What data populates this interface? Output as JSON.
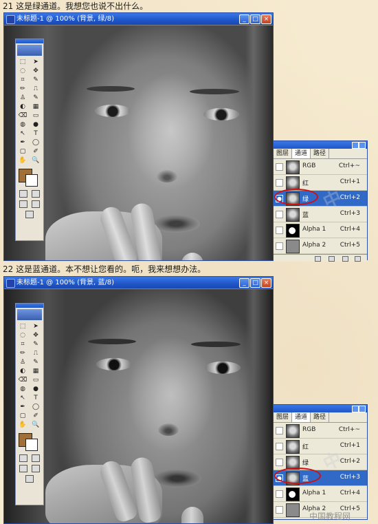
{
  "sections": [
    {
      "caption": "21 这是绿通道。我想您也说不出什么。",
      "window": {
        "title": "未标题-1 @ 100% (背景, 绿/8)",
        "buttons": {
          "minimize": "_",
          "maximize": "□",
          "close": "×"
        }
      },
      "channels_panel": {
        "tabs": [
          "图层",
          "通道",
          "路径"
        ],
        "active_tab": "通道",
        "rows": [
          {
            "name": "RGB",
            "shortcut": "Ctrl+~",
            "thumb": "face",
            "selected": false,
            "visible": false
          },
          {
            "name": "红",
            "shortcut": "Ctrl+1",
            "thumb": "face",
            "selected": false,
            "visible": false
          },
          {
            "name": "绿",
            "shortcut": "Ctrl+2",
            "thumb": "face",
            "selected": true,
            "visible": true
          },
          {
            "name": "蓝",
            "shortcut": "Ctrl+3",
            "thumb": "face",
            "selected": false,
            "visible": false
          },
          {
            "name": "Alpha 1",
            "shortcut": "Ctrl+4",
            "thumb": "alpha",
            "selected": false,
            "visible": false
          },
          {
            "name": "Alpha 2",
            "shortcut": "Ctrl+5",
            "thumb": "alpha2",
            "selected": false,
            "visible": false
          }
        ]
      }
    },
    {
      "caption": "22 这是蓝通道。本不想让您看的。呃，我来想想办法。",
      "window": {
        "title": "未标题-1 @ 100% (背景, 蓝/8)",
        "buttons": {
          "minimize": "_",
          "maximize": "□",
          "close": "×"
        }
      },
      "channels_panel": {
        "tabs": [
          "图层",
          "通道",
          "路径"
        ],
        "active_tab": "通道",
        "rows": [
          {
            "name": "RGB",
            "shortcut": "Ctrl+~",
            "thumb": "face",
            "selected": false,
            "visible": false
          },
          {
            "name": "红",
            "shortcut": "Ctrl+1",
            "thumb": "face",
            "selected": false,
            "visible": false
          },
          {
            "name": "绿",
            "shortcut": "Ctrl+2",
            "thumb": "face",
            "selected": false,
            "visible": false
          },
          {
            "name": "蓝",
            "shortcut": "Ctrl+3",
            "thumb": "face",
            "selected": true,
            "visible": true
          },
          {
            "name": "Alpha 1",
            "shortcut": "Ctrl+4",
            "thumb": "alpha",
            "selected": false,
            "visible": false
          },
          {
            "name": "Alpha 2",
            "shortcut": "Ctrl+5",
            "thumb": "alpha2",
            "selected": false,
            "visible": false
          }
        ]
      }
    }
  ],
  "tools": [
    "⬚",
    "➤",
    "◌",
    "✥",
    "⌗",
    "✎",
    "✏",
    "⎍",
    "♙",
    "✎",
    "◐",
    "▦",
    "⌫",
    "▭",
    "◍",
    "●",
    "↖",
    "T",
    "✒",
    "◯",
    "▢",
    "✐",
    "✋",
    "🔍"
  ],
  "colors": {
    "foreground": "#a0703a",
    "background": "#ffffff",
    "selected_row": "#3169c6",
    "highlight_oval": "#d10f10"
  },
  "watermark": "中国教程网"
}
